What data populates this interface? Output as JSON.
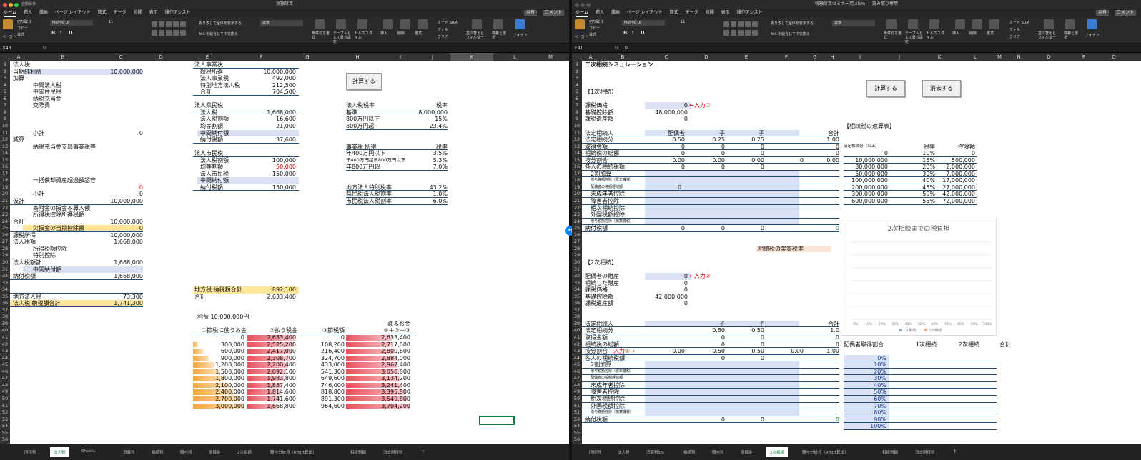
{
  "left": {
    "title": "税額計算",
    "autosave": "自動保存",
    "tabs_menu": [
      "ホーム",
      "挿入",
      "描画",
      "ページ レイアウト",
      "数式",
      "データ",
      "校閲",
      "表示",
      "操作アシスト"
    ],
    "share": "共有",
    "comment": "コメント",
    "ribbon": {
      "paste": "ペースト",
      "cut": "切り取り",
      "copy": "コピー",
      "format": "書式",
      "font": "Meiryo UI",
      "size": "11",
      "wrap": "折り返して全体を表示する",
      "merge": "セルを結合して中央揃え",
      "numfmt": "標準",
      "cond": "条件付き書式",
      "table": "テーブルとして書式設定",
      "style": "セルのスタイル",
      "ins": "挿入",
      "del": "削除",
      "fmt": "書式",
      "autosum": "オート SUM",
      "fill": "フィル",
      "clear": "クリア",
      "sort": "並べ替えとフィルター",
      "find": "検索と選択",
      "idea": "アイデア"
    },
    "namebox": "K43",
    "fx": "fx",
    "cols": [
      "A",
      "B",
      "C",
      "D",
      "E",
      "F",
      "G",
      "H",
      "I",
      "J",
      "K",
      "L",
      "M"
    ],
    "sheet_tabs": [
      "所得税",
      "法人税",
      "Sheet1",
      "消費税",
      "相続税",
      "贈与税",
      "退職金",
      "2次相続",
      "贈与分岐点（effort算出）",
      "相続税額",
      "消去所得税"
    ],
    "active_tab": "法人税",
    "btn_calc": "計算する",
    "colA": [
      [
        "法人税",
        1
      ],
      [
        "当期純利益",
        2
      ],
      [
        "加算",
        3
      ],
      [
        "減算",
        12
      ],
      [
        "仮計",
        21
      ],
      [
        "合計",
        24
      ],
      [
        "課税所得",
        26
      ],
      [
        "法人税額",
        27
      ],
      [
        "法人税額計",
        30
      ],
      [
        "納付税額",
        32
      ],
      [
        "地方法人税",
        35
      ],
      [
        "法人税 納税額合計",
        36
      ]
    ],
    "colB": [
      [
        "中間法人税",
        4
      ],
      [
        "中間住民税",
        5
      ],
      [
        "納税充当金",
        6
      ],
      [
        "交際費",
        7
      ],
      [
        "小計",
        11
      ],
      [
        "納税充当金支出事業税等",
        13
      ],
      [
        "一括償却資産超過額認容",
        18
      ],
      [
        "小計",
        20
      ],
      [
        "寄附金の損金不算入額",
        22
      ],
      [
        "所得税控除所得税額",
        23
      ],
      [
        "欠損金の当期控除額",
        25
      ],
      [
        "所得税額控除",
        28
      ],
      [
        "特別控除",
        29
      ],
      [
        "中間納付額",
        31
      ]
    ],
    "colC": [
      [
        "10,000,000",
        2
      ],
      [
        "0",
        11
      ],
      [
        "0",
        19
      ],
      [
        "0",
        20
      ],
      [
        "10,000,000",
        21
      ],
      [
        "10,000,000",
        24
      ],
      [
        "0",
        25
      ],
      [
        "10,000,000",
        26
      ],
      [
        "1,668,000",
        27
      ],
      [
        "1,668,000",
        30
      ],
      [
        "1,668,000",
        32
      ],
      [
        "73,300",
        35
      ],
      [
        "1,741,300",
        36
      ]
    ],
    "enterprise": [
      [
        "法人事業税",
        "",
        1
      ],
      [
        "課税所得",
        "10,000,000",
        2
      ],
      [
        "法人事業税",
        "492,000",
        3
      ],
      [
        "特別地方法人税",
        "212,500",
        4
      ],
      [
        "合計",
        "704,500",
        5
      ]
    ],
    "pref": [
      [
        "法人県民税",
        "",
        7
      ],
      [
        "法人税",
        "1,668,000",
        8
      ],
      [
        "法人税割額",
        "16,600",
        9
      ],
      [
        "均等割額",
        "21,000",
        10
      ],
      [
        "中間納付額",
        "",
        11
      ],
      [
        "納付税額",
        "37,600",
        12
      ]
    ],
    "city": [
      [
        "法人市民税",
        "",
        14
      ],
      [
        "法人税割額",
        "100,000",
        15
      ],
      [
        "均等割額",
        "50,000",
        16
      ],
      [
        "法人市民税",
        "150,000",
        17
      ],
      [
        "中間納付額",
        "",
        18
      ],
      [
        "納付税額",
        "150,000",
        19
      ]
    ],
    "local_total": [
      "地方税 納税額合計",
      "892,100"
    ],
    "total": [
      "合計",
      "2,633,400"
    ],
    "profit": "利益 10,000,000円",
    "tbl_head": [
      "①節税に使うお金",
      "②払う税金",
      "③節税額",
      "減るお金",
      "①＋②－③"
    ],
    "tbl_rows": [
      [
        "0",
        "2,633,400",
        "0",
        "2,633,400"
      ],
      [
        "300,000",
        "2,525,200",
        "108,200",
        "2,717,000"
      ],
      [
        "600,000",
        "2,417,000",
        "216,400",
        "2,800,600"
      ],
      [
        "900,000",
        "2,308,700",
        "324,700",
        "2,884,000"
      ],
      [
        "1,200,000",
        "2,200,400",
        "433,000",
        "2,967,400"
      ],
      [
        "1,500,000",
        "2,092,100",
        "541,300",
        "3,050,800"
      ],
      [
        "1,800,000",
        "1,983,800",
        "649,600",
        "3,134,200"
      ],
      [
        "2,100,000",
        "1,887,400",
        "746,000",
        "3,241,400"
      ],
      [
        "2,400,000",
        "1,814,600",
        "818,800",
        "3,395,800"
      ],
      [
        "2,700,000",
        "1,741,600",
        "891,300",
        "3,549,800"
      ],
      [
        "3,000,000",
        "1,668,800",
        "964,600",
        "3,704,200"
      ]
    ],
    "rates1": [
      [
        "法人税税率",
        "税率",
        7
      ],
      [
        "基準",
        "8,000,000",
        8
      ],
      [
        "800万円以下",
        "15%",
        9
      ],
      [
        "800万円超",
        "23.4%",
        10
      ]
    ],
    "rates2": [
      [
        "事業税 所得",
        "税率",
        13
      ],
      [
        "年400万円以下",
        "3.5%",
        14
      ],
      [
        "年400万円超年800万円以下",
        "5.3%",
        15
      ],
      [
        "年800万円超",
        "7.0%",
        16
      ]
    ],
    "rates3": [
      [
        "地方法人特別税率",
        "43.2%",
        19
      ],
      [
        "県民税法人税割率",
        "1.0%",
        20
      ],
      [
        "市民税法人税割率",
        "6.0%",
        21
      ]
    ]
  },
  "right": {
    "title": "税額計算セミナー用.xlsm — 読み取り専用",
    "namebox": "E41",
    "fx": "fx",
    "fval": "0",
    "cols": [
      "A",
      "B",
      "C",
      "D",
      "E",
      "F",
      "G",
      "H",
      "I",
      "J",
      "K",
      "L",
      "M",
      "N",
      "O",
      "P",
      "Q"
    ],
    "heading": "二次相続シミュレーション",
    "btn_calc": "計算する",
    "btn_clear": "消去する",
    "sec1": "【1次相続】",
    "sec2": "【2次相続】",
    "s1rows": [
      [
        "課税価格",
        "0",
        7
      ],
      [
        "基礎控除額",
        "48,000,000",
        8
      ],
      [
        "課税遺産額",
        "0",
        9
      ]
    ],
    "input1": "←入力①",
    "input2": "←入力②",
    "input3": "入力③→",
    "heirs_head": [
      "法定相続人",
      "配偶者",
      "子",
      "子",
      "合計"
    ],
    "s1grid": [
      [
        "法定相続分",
        "0.50",
        "0.25",
        "0.25",
        "",
        "1.00",
        12
      ],
      [
        "取得金額",
        "0",
        "0",
        "0",
        "",
        "0",
        13
      ],
      [
        "相続税の総額",
        "0",
        "0",
        "0",
        "",
        "0",
        14
      ],
      [
        "按分割合",
        "0.00",
        "0.00",
        "0.00",
        "0",
        "0.00",
        15
      ],
      [
        "各人の相続税額",
        "0",
        "0",
        "0",
        "",
        "",
        16
      ]
    ],
    "s1sub": [
      [
        "2割加算",
        17
      ],
      [
        "贈与税額控除（暦年課税）",
        18
      ],
      [
        "配偶者の税額軽減額",
        19
      ],
      [
        "未成年者控除",
        20
      ],
      [
        "障害者控除",
        21
      ],
      [
        "相次相続控除",
        22
      ],
      [
        "外国税額控除",
        23
      ],
      [
        "贈与税額控除（精算課税）",
        24
      ]
    ],
    "s1pay": [
      "納付税額",
      "0",
      "0",
      "0",
      "",
      "0"
    ],
    "rate_label": "相続税の実質税率",
    "s2rows": [
      [
        "配偶者の財産",
        "0",
        31
      ],
      [
        "相続した財産",
        "0",
        32
      ],
      [
        "課税価格",
        "0",
        33
      ],
      [
        "基礎控除額",
        "42,000,000",
        34
      ],
      [
        "課税遺産額",
        "0",
        35
      ]
    ],
    "s2head": [
      "法定相続人",
      "子",
      "子",
      "合計"
    ],
    "s2grid": [
      [
        "法定相続分",
        "0.50",
        "0.50",
        "1.0",
        38
      ],
      [
        "取得金額",
        "0",
        "0",
        "0",
        39
      ],
      [
        "相続税の総額",
        "0",
        "0",
        "0",
        40
      ],
      [
        "按分割合",
        "0.00",
        "0.50",
        "0.50",
        "0.00",
        "1.00",
        41
      ],
      [
        "各人の相続税額",
        "0",
        "0",
        "",
        42
      ]
    ],
    "s2sub": [
      [
        "2割加算",
        43
      ],
      [
        "贈与税額控除（暦年課税）",
        44
      ],
      [
        "配偶者の税額軽減額",
        45
      ],
      [
        "未成年者控除",
        46
      ],
      [
        "障害者控除",
        47
      ],
      [
        "相次相続控除",
        48
      ],
      [
        "外国税額控除",
        49
      ],
      [
        "贈与税額控除（精算課税）",
        50
      ]
    ],
    "s2pay": [
      "納付税額",
      "0",
      "0",
      "0"
    ],
    "quick": "【相続税の速算表】",
    "quick_head": [
      "法定相続分（以上）",
      "税率",
      "控除額"
    ],
    "quick_rows": [
      [
        "0",
        "10%",
        "0"
      ],
      [
        "10,000,000",
        "15%",
        "500,000"
      ],
      [
        "30,000,000",
        "20%",
        "2,000,000"
      ],
      [
        "50,000,000",
        "30%",
        "7,000,000"
      ],
      [
        "100,000,000",
        "40%",
        "17,000,000"
      ],
      [
        "200,000,000",
        "45%",
        "27,000,000"
      ],
      [
        "300,000,000",
        "50%",
        "42,000,000"
      ],
      [
        "600,000,000",
        "55%",
        "72,000,000"
      ]
    ],
    "chart_title": "2次相続までの税負担",
    "chart_x": [
      "0%",
      "10%",
      "20%",
      "30%",
      "40%",
      "50%",
      "60%",
      "70%",
      "80%",
      "90%",
      "100%"
    ],
    "chart_legend": [
      "1次相続",
      "2次相続"
    ],
    "ratio_head": [
      "配偶者取得割合",
      "1次相続",
      "2次相続",
      "合計"
    ],
    "ratios": [
      "0%",
      "10%",
      "20%",
      "30%",
      "40%",
      "50%",
      "60%",
      "70%",
      "80%",
      "90%",
      "100%"
    ],
    "sheet_tabs": [
      "所得税",
      "法人税",
      "消費税5%",
      "相続税",
      "贈与税",
      "退職金",
      "2次相続",
      "贈与分岐点（effort算出）",
      "相続税額",
      "消去所得税"
    ],
    "active_tab": "2次相続"
  },
  "chart_data": {
    "type": "line",
    "title": "2次相続までの税負担",
    "categories": [
      "0%",
      "10%",
      "20%",
      "30%",
      "40%",
      "50%",
      "60%",
      "70%",
      "80%",
      "90%",
      "100%"
    ],
    "series": [
      {
        "name": "1次相続",
        "values": []
      },
      {
        "name": "2次相続",
        "values": []
      }
    ]
  },
  "colors": {
    "accent": "#107c41",
    "blue_fill": "#d9e1f2",
    "yellow": "#ffe699",
    "peach": "#fce4d6",
    "orange_bar": "#f4a53a",
    "red_bar": "#e8505b",
    "red_text": "#e00000"
  }
}
